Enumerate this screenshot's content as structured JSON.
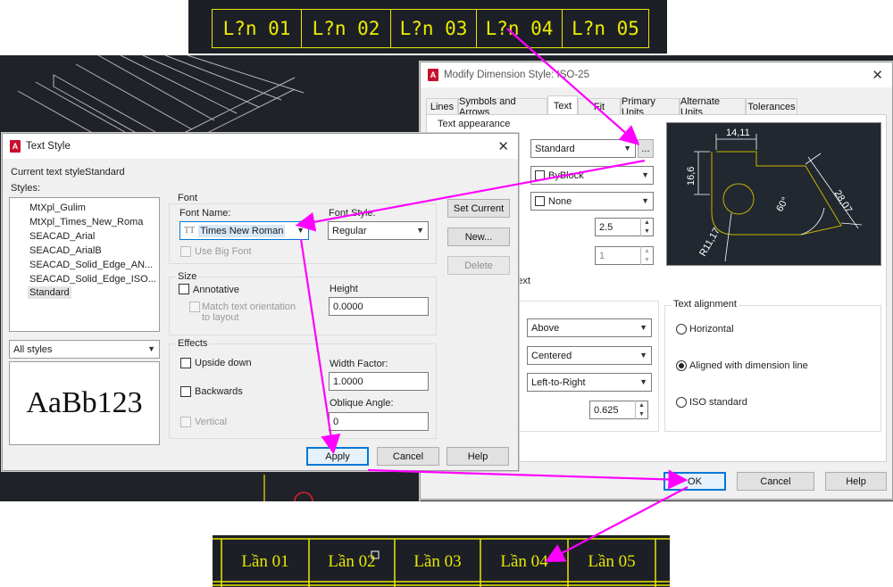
{
  "cad_top": {
    "cells": [
      "L?n 01",
      "L?n 02",
      "L?n 03",
      "L?n 04",
      "L?n 05"
    ]
  },
  "cad_bottom": {
    "cells": [
      "Lần 01",
      "Lần 02",
      "Lần 03",
      "Lần 04",
      "Lần 05"
    ]
  },
  "dim_dialog": {
    "logo": "A",
    "title": "Modify Dimension Style: ISO-25",
    "tabs": [
      "Lines",
      "Symbols and Arrows",
      "Text",
      "Fit",
      "Primary Units",
      "Alternate Units",
      "Tolerances"
    ],
    "text_appearance_label": "Text appearance",
    "text_style_value": "Standard",
    "ellipsis": "...",
    "text_color_value": "ByBlock",
    "fill_color_value": "None",
    "text_height_value": "2.5",
    "fraction_scale_value": "1",
    "frame_text_fragment": "d text",
    "colon_fragment": ":",
    "vertical_value": "Above",
    "horizontal_value": "Centered",
    "view_direction_value": "Left-to-Right",
    "offset_value": "0.625",
    "alignment": {
      "title": "Text alignment",
      "options": [
        "Horizontal",
        "Aligned with dimension line",
        "ISO standard"
      ],
      "selected": "Aligned with dimension line"
    },
    "preview_dims": {
      "width": "14,11",
      "height": "16,6",
      "diag": "28,07",
      "angle": "60°",
      "radius": "R11,17"
    },
    "buttons": {
      "ok": "OK",
      "cancel": "Cancel",
      "help": "Help"
    }
  },
  "text_style_dialog": {
    "logo": "A",
    "title": "Text Style",
    "current_style_label": "Current text style:",
    "current_style_value": "Standard",
    "styles_label": "Styles:",
    "styles": [
      "MtXpl_Gulim",
      "MtXpl_Times_New_Roma",
      "SEACAD_Arial",
      "SEACAD_ArialB",
      "SEACAD_Solid_Edge_AN...",
      "SEACAD_Solid_Edge_ISO...",
      "Standard"
    ],
    "selected_style": "Standard",
    "filter_value": "All styles",
    "preview_text": "AaBb123",
    "font_group": "Font",
    "font_name_label": "Font Name:",
    "font_name_value": "Times New Roman",
    "font_name_icon": "TT",
    "font_style_label": "Font Style:",
    "font_style_value": "Regular",
    "use_big_font": "Use Big Font",
    "size_group": "Size",
    "annotative": "Annotative",
    "match_orientation": "Match text orientation to layout",
    "height_label": "Height",
    "height_value": "0.0000",
    "effects_group": "Effects",
    "upside_down": "Upside down",
    "backwards": "Backwards",
    "vertical": "Vertical",
    "width_factor_label": "Width Factor:",
    "width_factor_value": "1.0000",
    "oblique_label": "Oblique Angle:",
    "oblique_value": "0",
    "buttons": {
      "set_current": "Set Current",
      "new": "New...",
      "delete": "Delete",
      "apply": "Apply",
      "cancel": "Cancel",
      "help": "Help"
    }
  },
  "colors": {
    "annotation_arrow": "#ff00ff",
    "cad_text": "#e8e800",
    "cad_bg": "#1c1f26",
    "focus": "#0078d7"
  }
}
